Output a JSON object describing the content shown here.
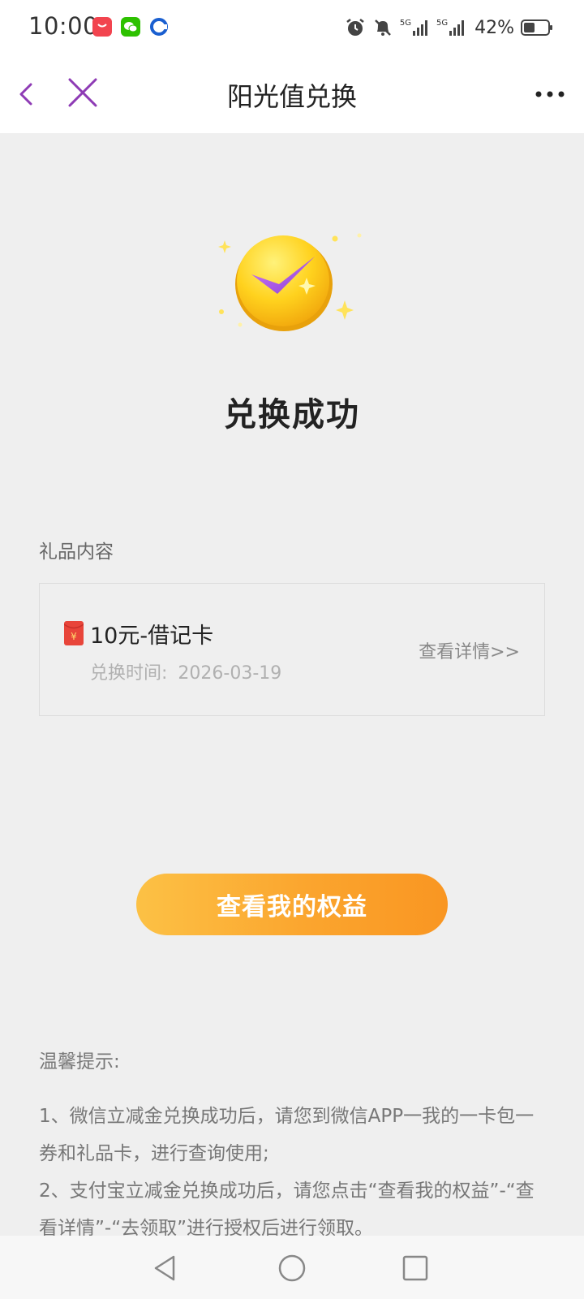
{
  "status_bar": {
    "time": "10:00",
    "battery_percent": "42%",
    "network_labels": [
      "5G",
      "5G"
    ],
    "icons": [
      "shopping-bag-icon",
      "wechat-icon",
      "browser-icon",
      "alarm-icon",
      "mute-bell-icon",
      "signal-icon",
      "battery-icon"
    ]
  },
  "nav": {
    "title": "阳光值兑换",
    "icons": [
      "back-chevron-icon",
      "close-icon",
      "more-icon"
    ],
    "accent_color": "#8e3bb5"
  },
  "result": {
    "title": "兑换成功",
    "icon": "success-check-coin-icon"
  },
  "gift": {
    "section_label": "礼品内容",
    "name": "10元-借记卡",
    "time_label": "兑换时间:",
    "time_value": "2026-03-19",
    "detail_link": "查看详情>>",
    "icon": "red-envelope-icon"
  },
  "actions": {
    "primary_label": "查看我的权益",
    "primary_color": "#f99622"
  },
  "tips": {
    "title": "温馨提示:",
    "items": [
      "1、微信立减金兑换成功后，请您到微信APP一我的一卡包一券和礼品卡，进行查询使用;",
      "2、支付宝立减金兑换成功后，请您点击“查看我的权益”-“查看详情”-“去领取”进行授权后进行领取。"
    ]
  },
  "system_nav": {
    "icons": [
      "back-triangle-icon",
      "home-circle-icon",
      "recents-square-icon"
    ]
  }
}
